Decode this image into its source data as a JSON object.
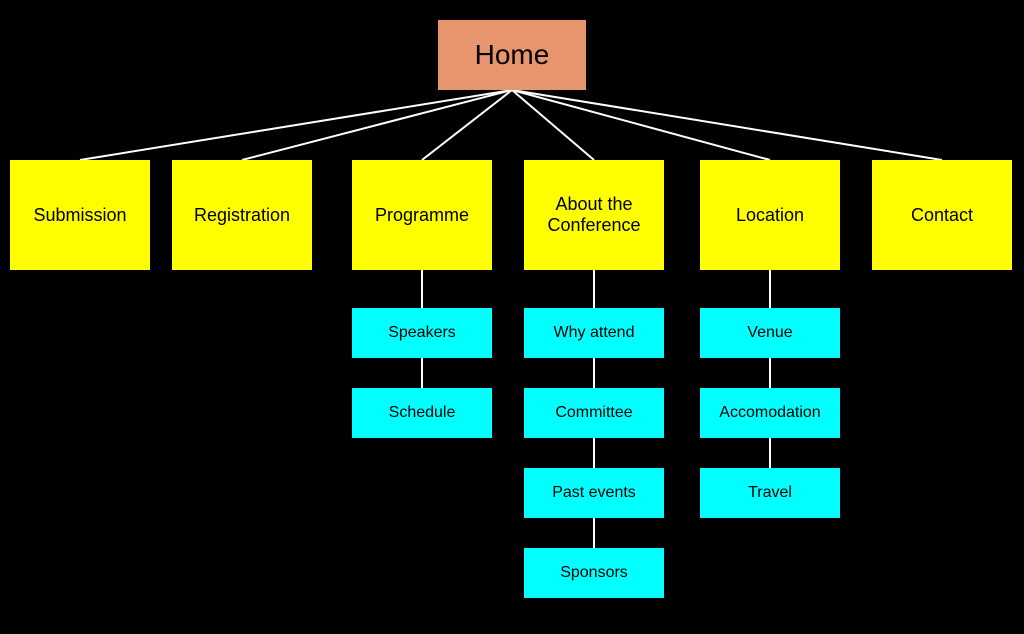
{
  "nodes": {
    "home": "Home",
    "submission": "Submission",
    "registration": "Registration",
    "programme": "Programme",
    "about": "About the Conference",
    "location": "Location",
    "contact": "Contact",
    "speakers": "Speakers",
    "schedule": "Schedule",
    "why_attend": "Why  attend",
    "committee": "Committee",
    "past_events": "Past  events",
    "sponsors": "Sponsors",
    "venue": "Venue",
    "accomodation": "Accomodation",
    "travel": "Travel"
  }
}
